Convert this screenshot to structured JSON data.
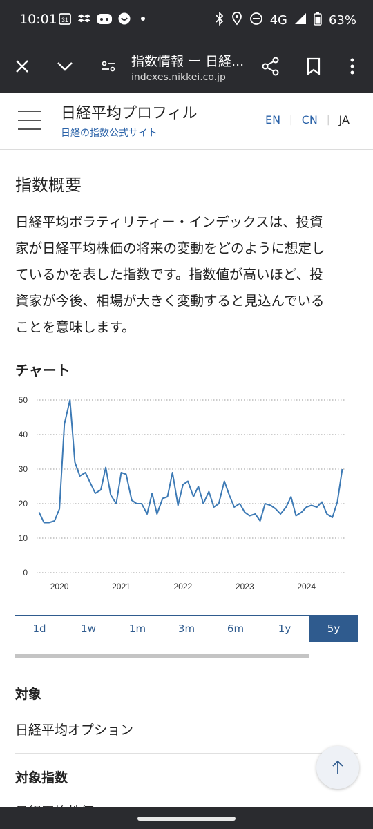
{
  "status": {
    "time": "10:01",
    "notif_badge": "31",
    "network": "4G",
    "battery": "63%"
  },
  "browser": {
    "title": "指数情報 ー 日経...",
    "url": "indexes.nikkei.co.jp"
  },
  "site": {
    "title": "日経平均プロフィル",
    "subtitle": "日経の指数公式サイト",
    "langs": [
      "EN",
      "CN",
      "JA"
    ]
  },
  "overview": {
    "heading": "指数概要",
    "lines": [
      "日経平均ボラティリティー・インデックスは、投資",
      "家が日経平均株価の将来の変動をどのように想定し",
      "ているかを表した指数です。指数値が高いほど、投",
      "資家が今後、相場が大きく変動すると見込んでいる",
      "ことを意味します。"
    ]
  },
  "chart_section": {
    "heading": "チャート"
  },
  "chart_data": {
    "type": "line",
    "xlabel": "",
    "ylabel": "",
    "ylim": [
      0,
      50
    ],
    "yticks": [
      "0",
      "10",
      "20",
      "30",
      "40",
      "50"
    ],
    "xticks": [
      {
        "label": "2020",
        "x": 2020.0
      },
      {
        "label": "2021",
        "x": 2021.0
      },
      {
        "label": "2022",
        "x": 2022.0
      },
      {
        "label": "2023",
        "x": 2023.0
      },
      {
        "label": "2024",
        "x": 2024.0
      }
    ],
    "xlim": [
      2019.63,
      2024.63
    ],
    "grid": true,
    "color": "#3d7ab5",
    "x": [
      2019.67,
      2019.75,
      2019.83,
      2019.92,
      2020.0,
      2020.08,
      2020.17,
      2020.25,
      2020.33,
      2020.42,
      2020.5,
      2020.58,
      2020.67,
      2020.75,
      2020.83,
      2020.92,
      2021.0,
      2021.08,
      2021.17,
      2021.25,
      2021.33,
      2021.42,
      2021.5,
      2021.58,
      2021.67,
      2021.75,
      2021.83,
      2021.92,
      2022.0,
      2022.08,
      2022.17,
      2022.25,
      2022.33,
      2022.42,
      2022.5,
      2022.58,
      2022.67,
      2022.75,
      2022.83,
      2022.92,
      2023.0,
      2023.08,
      2023.17,
      2023.25,
      2023.33,
      2023.42,
      2023.5,
      2023.58,
      2023.67,
      2023.75,
      2023.83,
      2023.92,
      2024.0,
      2024.08,
      2024.17,
      2024.25,
      2024.33,
      2024.42,
      2024.5,
      2024.58
    ],
    "values": [
      17.5,
      14.5,
      14.5,
      15,
      18.5,
      43,
      50,
      32,
      28,
      29,
      26,
      23,
      24,
      30.5,
      22.5,
      20,
      29,
      28.5,
      21,
      20,
      20,
      17,
      23,
      17,
      21.5,
      22,
      29,
      19.5,
      25.5,
      26.5,
      22,
      25,
      20,
      23.5,
      19,
      20,
      26.5,
      22.5,
      19,
      20,
      17.5,
      16.5,
      17,
      15,
      20,
      19.5,
      18.5,
      17,
      19,
      22,
      16.5,
      17.5,
      19,
      19.5,
      19,
      20.5,
      17,
      16,
      20.5,
      30
    ]
  },
  "ranges": [
    "1d",
    "1w",
    "1m",
    "3m",
    "6m",
    "1y",
    "5y"
  ],
  "active_range": "5y",
  "info": [
    {
      "label": "対象",
      "value": "日経平均オプション"
    },
    {
      "label": "対象指数",
      "value": "日経平均株価"
    }
  ]
}
